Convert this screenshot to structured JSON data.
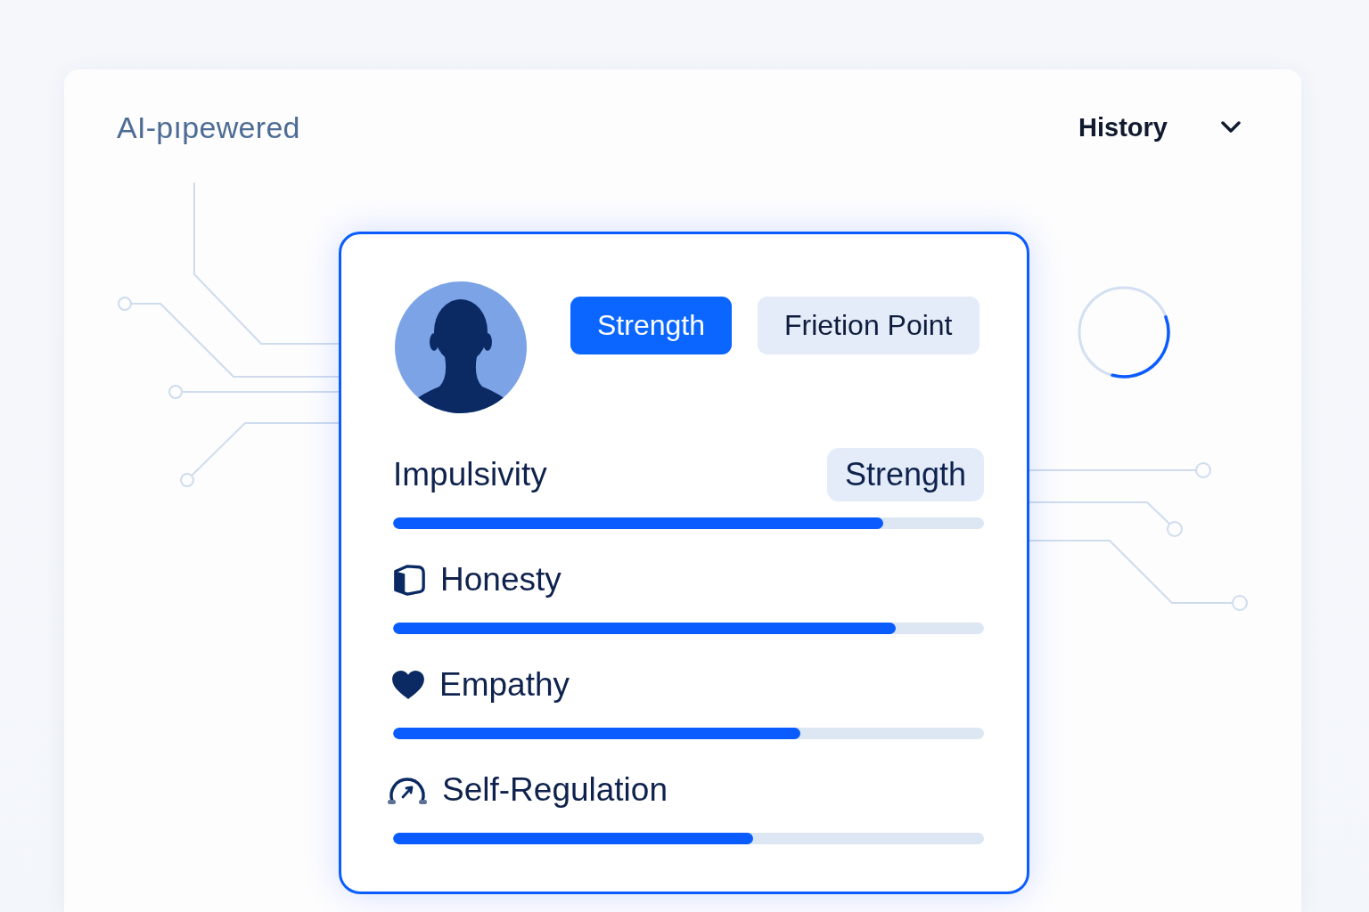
{
  "header": {
    "title": "AI-pıpewered",
    "history_menu": {
      "label": "History"
    }
  },
  "profile_card": {
    "tabs": [
      {
        "label": "Strength",
        "selected": true
      },
      {
        "label": "Frietion Point",
        "selected": false
      }
    ],
    "metrics": [
      {
        "name": "Impulsivity",
        "badge": "Strength",
        "level": 0.83
      },
      {
        "name": "Honesty",
        "level": 0.85
      },
      {
        "name": "Empathy",
        "level": 0.69
      },
      {
        "name": "Self-Regulation",
        "level": 0.61
      }
    ]
  }
}
